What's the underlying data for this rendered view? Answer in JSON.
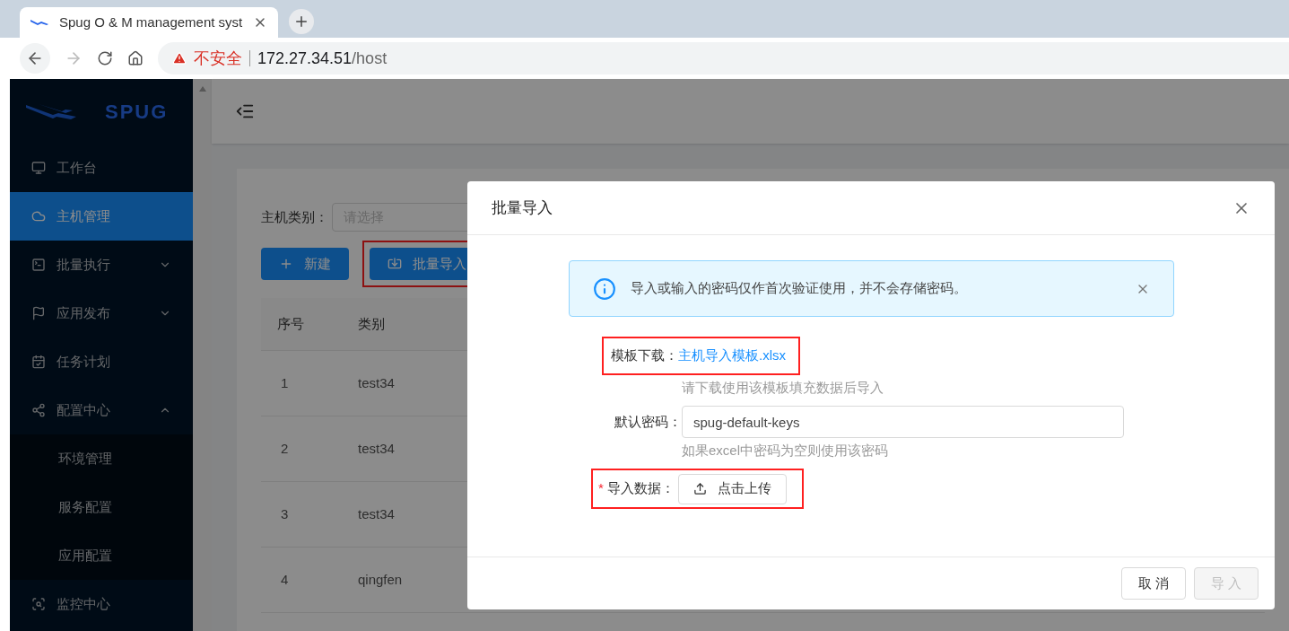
{
  "browser": {
    "tab_title": "Spug O & M management syst",
    "security_warning": "不安全",
    "url_host": "172.27.34.51",
    "url_path": "/host"
  },
  "sidebar": {
    "logo_text": "SPUG",
    "items": [
      {
        "label": "工作台",
        "selected": false
      },
      {
        "label": "主机管理",
        "selected": true
      },
      {
        "label": "批量执行",
        "selected": false,
        "expanded": false
      },
      {
        "label": "应用发布",
        "selected": false,
        "expanded": false
      },
      {
        "label": "任务计划",
        "selected": false
      },
      {
        "label": "配置中心",
        "selected": false,
        "expanded": true,
        "children": [
          {
            "label": "环境管理",
            "selected": false
          },
          {
            "label": "服务配置",
            "selected": false
          },
          {
            "label": "应用配置",
            "selected": false
          }
        ]
      },
      {
        "label": "监控中心",
        "selected": false
      }
    ]
  },
  "filter": {
    "label": "主机类别：",
    "placeholder": "请选择"
  },
  "actions": [
    {
      "label": "新建",
      "kind": "add",
      "highlighted": false
    },
    {
      "label": "批量导入",
      "kind": "import",
      "highlighted": true
    }
  ],
  "table": {
    "columns": [
      "序号",
      "类别"
    ],
    "rows": [
      [
        "1",
        "test34"
      ],
      [
        "2",
        "test34"
      ],
      [
        "3",
        "test34"
      ],
      [
        "4",
        "qingfen"
      ]
    ]
  },
  "modal": {
    "title": "批量导入",
    "alert": "导入或输入的密码仅作首次验证使用，并不会存储密码。",
    "template": {
      "label": "模板下载：",
      "link": "主机导入模板.xlsx",
      "hint": "请下载使用该模板填充数据后导入",
      "highlighted": true
    },
    "password": {
      "label": "默认密码：",
      "value": "spug-default-keys",
      "hint": "如果excel中密码为空则使用该密码"
    },
    "upload": {
      "required": true,
      "required_mark": "*",
      "label": "导入数据：",
      "button": "点击上传",
      "highlighted": true
    },
    "buttons": [
      {
        "label": "取 消",
        "disabled": false
      },
      {
        "label": "导 入",
        "disabled": true
      }
    ]
  }
}
